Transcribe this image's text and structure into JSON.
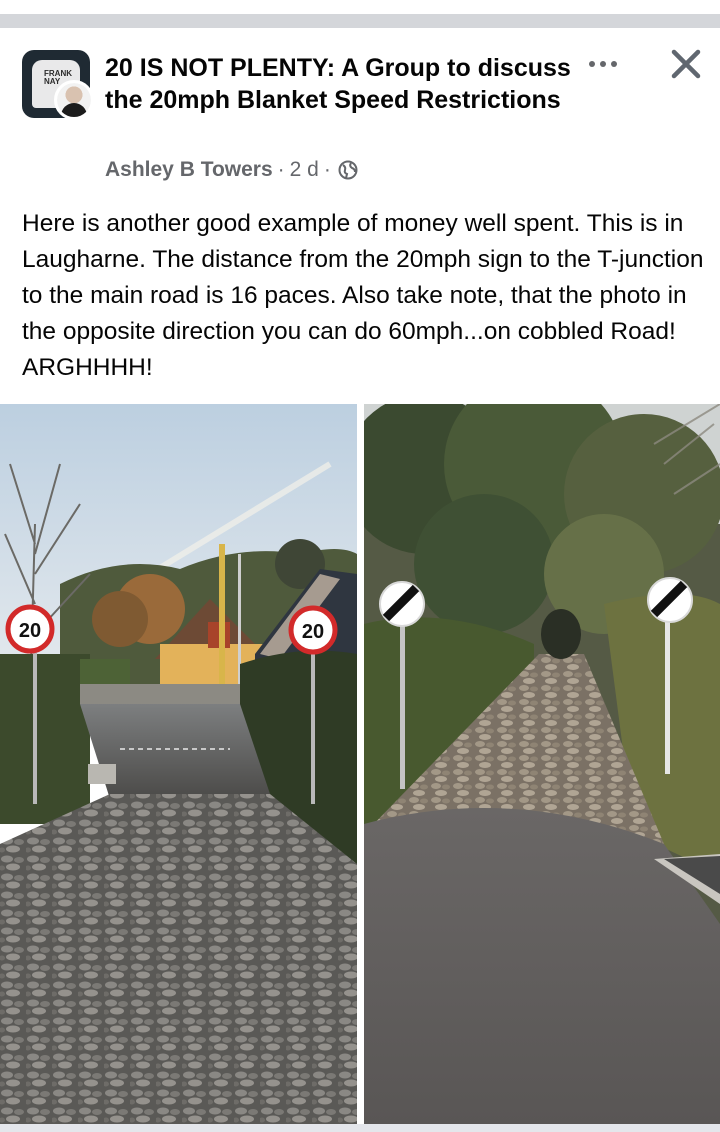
{
  "group": {
    "title": "20 IS NOT PLENTY: A Group to discuss the 20mph Blanket Speed Restrictions",
    "avatar_shirt_text": "FRANK NAY"
  },
  "post": {
    "author": "Ashley B Towers",
    "time": "2 d",
    "separator": "·",
    "privacy_icon": "globe-icon",
    "text": "Here is another good example of money well spent. This is in Laugharne. The distance from the 20mph sign to the T-junction to the main road is 16 paces. Also take note, that the photo in the opposite direction you can do 60mph...on cobbled Road! ARGHHHH!"
  },
  "actions": {
    "more_icon": "more-options-icon",
    "close_icon": "close-icon"
  },
  "photos": {
    "left_sign_left": "20",
    "left_sign_right": "20"
  },
  "colors": {
    "title_text": "#050505",
    "meta_text": "#65676b",
    "divider": "#d4d6da"
  }
}
